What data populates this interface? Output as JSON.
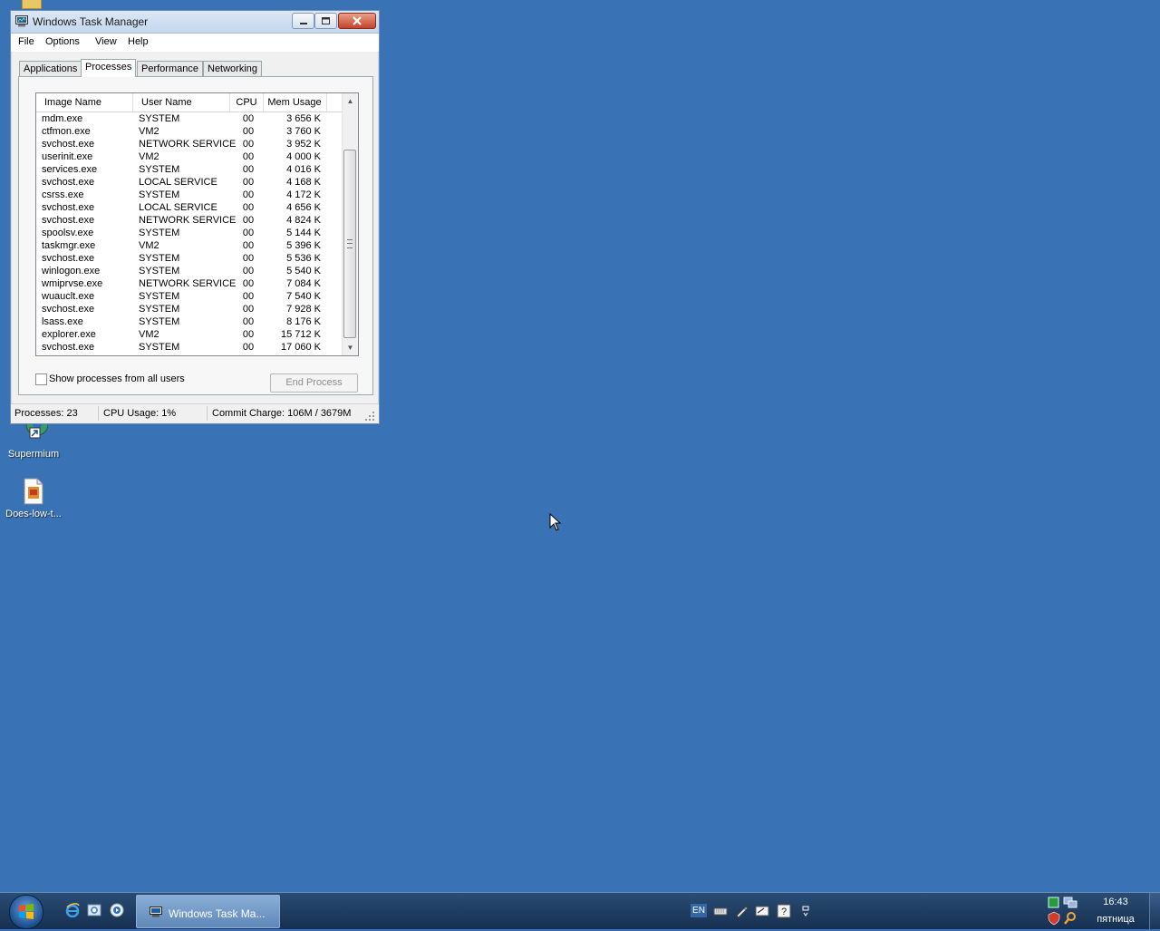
{
  "desktop": {
    "icons": [
      {
        "label": "Supermium"
      },
      {
        "label": "Does-low-t..."
      }
    ]
  },
  "window": {
    "title": "Windows Task Manager",
    "menu": [
      "File",
      "Options",
      "View",
      "Help"
    ],
    "tabs": [
      "Applications",
      "Processes",
      "Performance",
      "Networking"
    ],
    "active_tab": "Processes",
    "columns": {
      "image": "Image Name",
      "user": "User Name",
      "cpu": "CPU",
      "mem": "Mem Usage"
    },
    "processes": [
      {
        "image": "mdm.exe",
        "user": "SYSTEM",
        "cpu": "00",
        "mem": "3 656 K"
      },
      {
        "image": "ctfmon.exe",
        "user": "VM2",
        "cpu": "00",
        "mem": "3 760 K"
      },
      {
        "image": "svchost.exe",
        "user": "NETWORK SERVICE",
        "cpu": "00",
        "mem": "3 952 K"
      },
      {
        "image": "userinit.exe",
        "user": "VM2",
        "cpu": "00",
        "mem": "4 000 K"
      },
      {
        "image": "services.exe",
        "user": "SYSTEM",
        "cpu": "00",
        "mem": "4 016 K"
      },
      {
        "image": "svchost.exe",
        "user": "LOCAL SERVICE",
        "cpu": "00",
        "mem": "4 168 K"
      },
      {
        "image": "csrss.exe",
        "user": "SYSTEM",
        "cpu": "00",
        "mem": "4 172 K"
      },
      {
        "image": "svchost.exe",
        "user": "LOCAL SERVICE",
        "cpu": "00",
        "mem": "4 656 K"
      },
      {
        "image": "svchost.exe",
        "user": "NETWORK SERVICE",
        "cpu": "00",
        "mem": "4 824 K"
      },
      {
        "image": "spoolsv.exe",
        "user": "SYSTEM",
        "cpu": "00",
        "mem": "5 144 K"
      },
      {
        "image": "taskmgr.exe",
        "user": "VM2",
        "cpu": "00",
        "mem": "5 396 K"
      },
      {
        "image": "svchost.exe",
        "user": "SYSTEM",
        "cpu": "00",
        "mem": "5 536 K"
      },
      {
        "image": "winlogon.exe",
        "user": "SYSTEM",
        "cpu": "00",
        "mem": "5 540 K"
      },
      {
        "image": "wmiprvse.exe",
        "user": "NETWORK SERVICE",
        "cpu": "00",
        "mem": "7 084 K"
      },
      {
        "image": "wuauclt.exe",
        "user": "SYSTEM",
        "cpu": "00",
        "mem": "7 540 K"
      },
      {
        "image": "svchost.exe",
        "user": "SYSTEM",
        "cpu": "00",
        "mem": "7 928 K"
      },
      {
        "image": "lsass.exe",
        "user": "SYSTEM",
        "cpu": "00",
        "mem": "8 176 K"
      },
      {
        "image": "explorer.exe",
        "user": "VM2",
        "cpu": "00",
        "mem": "15 712 K"
      },
      {
        "image": "svchost.exe",
        "user": "SYSTEM",
        "cpu": "00",
        "mem": "17 060 K"
      }
    ],
    "show_all_users_label": "Show processes from all users",
    "show_all_users_checked": false,
    "end_process_label": "End Process",
    "status": {
      "processes": "Processes: 23",
      "cpu": "CPU Usage: 1%",
      "commit": "Commit Charge: 106M / 3679M"
    }
  },
  "taskbar": {
    "task_button": "Windows Task Ma...",
    "language": "EN",
    "time": "16:43",
    "day": "пятница"
  },
  "colors": {
    "desktop": "#3a72b6",
    "taskbar": "#1f3c60"
  }
}
